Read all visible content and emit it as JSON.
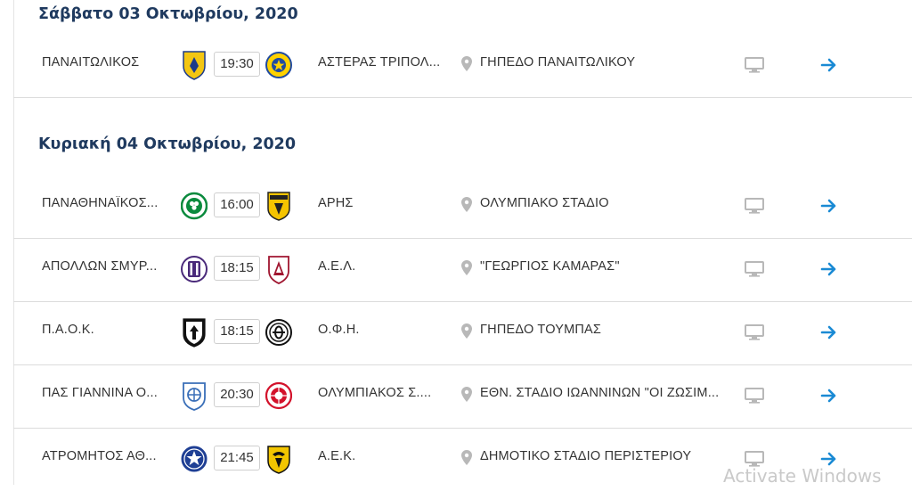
{
  "days": [
    {
      "heading": "Σάββατο 03 Οκτωβρίου, 2020",
      "matches": [
        {
          "home": "ΠΑΝΑΙΤΩΛΙΚΟΣ",
          "time": "19:30",
          "away": "ΑΣΤΕΡΑΣ ΤΡΙΠΟΛ...",
          "venue": "ΓΗΠΕΔΟ ΠΑΝΑΙΤΩΛΙΚΟΥ",
          "home_crest": "panaitolikos-crest-icon",
          "away_crest": "asteras-tripolis-crest-icon"
        }
      ]
    },
    {
      "heading": "Κυριακή 04 Οκτωβρίου, 2020",
      "matches": [
        {
          "home": "ΠΑΝΑΘΗΝΑΪΚΟΣ...",
          "time": "16:00",
          "away": "ΑΡΗΣ",
          "venue": "ΟΛΥΜΠΙΑΚΟ ΣΤΑΔΙΟ",
          "home_crest": "panathinaikos-crest-icon",
          "away_crest": "aris-crest-icon"
        },
        {
          "home": "ΑΠΟΛΛΩΝ ΣΜΥΡ...",
          "time": "18:15",
          "away": "Α.Ε.Λ.",
          "venue": "\"ΓΕΩΡΓΙΟΣ ΚΑΜΑΡΑΣ\"",
          "home_crest": "apollon-smyrnis-crest-icon",
          "away_crest": "ael-crest-icon"
        },
        {
          "home": "Π.Α.Ο.Κ.",
          "time": "18:15",
          "away": "Ο.Φ.Η.",
          "venue": "ΓΗΠΕΔΟ ΤΟΥΜΠΑΣ",
          "home_crest": "paok-crest-icon",
          "away_crest": "ofi-crest-icon"
        },
        {
          "home": "ΠΑΣ ΓΙΑΝΝΙΝΑ Ο...",
          "time": "20:30",
          "away": "ΟΛΥΜΠΙΑΚΟΣ Σ....",
          "venue": "ΕΘΝ. ΣΤΑΔΙΟ ΙΩΑΝΝΙΝΩΝ \"ΟΙ ΖΩΣΙΜ...",
          "home_crest": "pas-giannina-crest-icon",
          "away_crest": "olympiacos-crest-icon"
        },
        {
          "home": "ΑΤΡΟΜΗΤΟΣ ΑΘ...",
          "time": "21:45",
          "away": "Α.Ε.Κ.",
          "venue": "ΔΗΜΟΤΙΚΟ ΣΤΑΔΙΟ ΠΕΡΙΣΤΕΡΙΟΥ",
          "home_crest": "atromitos-crest-icon",
          "away_crest": "aek-crest-icon"
        }
      ]
    }
  ],
  "icons": {
    "venue": "location-pin-icon",
    "broadcast": "tv-icon",
    "details": "arrow-right-icon"
  },
  "colors": {
    "heading": "#1f3a5f",
    "arrow": "#1a8ad4",
    "icon_grey": "#b8b8b8",
    "divider": "#dcdcdc"
  },
  "watermark": "Activate Windows"
}
